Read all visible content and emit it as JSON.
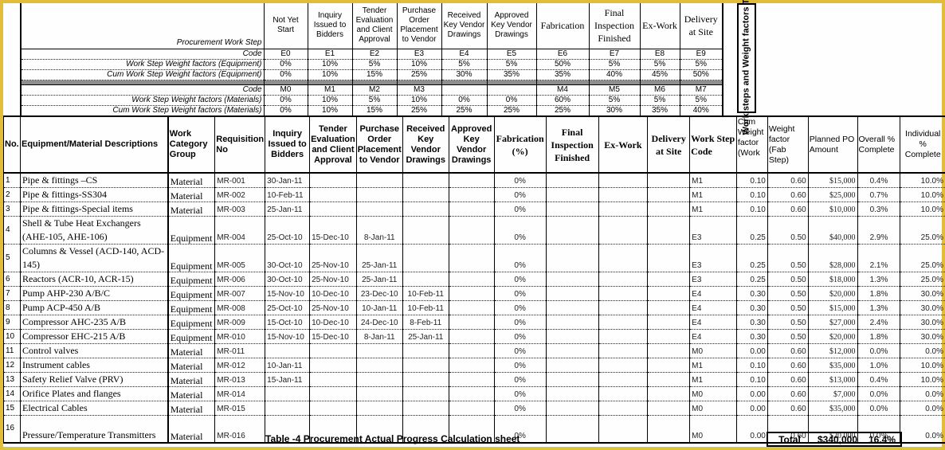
{
  "weight_table": {
    "side_title": "Work steps and Weight factors Table",
    "row_labels": {
      "step": "Procurement Work Step",
      "code_e": "Code",
      "weight_e": "Work Step Weight factors (Equipment)",
      "cum_e": "Cum Work Step Weight factors (Equipment)",
      "code_m": "Code",
      "weight_m": "Work Step Weight factors (Materials)",
      "cum_m": "Cum Work Step Weight factors (Materials)"
    },
    "steps": [
      {
        "name": "Not Yet Start",
        "code_e": "E0",
        "weight_e": "0%",
        "cum_e": "0%",
        "code_m": "M0",
        "weight_m": "0%",
        "cum_m": "0%"
      },
      {
        "name": "Inquiry Issued to Bidders",
        "code_e": "E1",
        "weight_e": "10%",
        "cum_e": "10%",
        "code_m": "M1",
        "weight_m": "10%",
        "cum_m": "10%"
      },
      {
        "name": "Tender Evaluation and Client Approval",
        "code_e": "E2",
        "weight_e": "5%",
        "cum_e": "15%",
        "code_m": "M2",
        "weight_m": "5%",
        "cum_m": "15%"
      },
      {
        "name": "Purchase Order Placement to Vendor",
        "code_e": "E3",
        "weight_e": "10%",
        "cum_e": "25%",
        "code_m": "M3",
        "weight_m": "10%",
        "cum_m": "25%"
      },
      {
        "name": "Received Key Vendor Drawings",
        "code_e": "E4",
        "weight_e": "5%",
        "cum_e": "30%",
        "code_m": "",
        "weight_m": "0%",
        "cum_m": "25%"
      },
      {
        "name": "Approved Key Vendor Drawings",
        "code_e": "E5",
        "weight_e": "5%",
        "cum_e": "35%",
        "code_m": "",
        "weight_m": "0%",
        "cum_m": "25%"
      },
      {
        "name": "Fabrication",
        "code_e": "E6",
        "weight_e": "50%",
        "cum_e": "35%",
        "code_m": "M4",
        "weight_m": "60%",
        "cum_m": "25%"
      },
      {
        "name": "Final Inspection Finished",
        "code_e": "E7",
        "weight_e": "5%",
        "cum_e": "40%",
        "code_m": "M5",
        "weight_m": "5%",
        "cum_m": "30%"
      },
      {
        "name": "Ex-Work",
        "code_e": "E8",
        "weight_e": "5%",
        "cum_e": "45%",
        "code_m": "M6",
        "weight_m": "5%",
        "cum_m": "35%"
      },
      {
        "name": "Delivery at Site",
        "code_e": "E9",
        "weight_e": "5%",
        "cum_e": "50%",
        "code_m": "M7",
        "weight_m": "5%",
        "cum_m": "40%"
      }
    ]
  },
  "main_table": {
    "headers": {
      "no": "No.",
      "desc": "Equipment/Material Descriptions",
      "category": "Work Category Group",
      "req": "Requisition No",
      "inquiry": "Inquiry Issued to Bidders",
      "tender": "Tender Evaluation and Client Approval",
      "po": "Purchase Order Placement to Vendor",
      "received": "Received Key Vendor Drawings",
      "approved": "Approved Key Vendor Drawings",
      "fabrication": "Fabrication (%)",
      "final": "Final Inspection Finished",
      "exwork": "Ex-Work",
      "delivery": "Delivery at Site",
      "step_code": "Work Step Code",
      "cum_weight": "Cum Weight factor (Work",
      "weight_fab": "Weight factor (Fab Step)",
      "planned_po": "Planned PO Amount",
      "overall": "Overall % Complete",
      "individual": "Individual % Complete"
    },
    "rows": [
      {
        "no": "1",
        "desc": "Pipe & fittings –CS",
        "category": "Material",
        "req": "MR-001",
        "inquiry": "30-Jan-11",
        "tender": "",
        "po": "",
        "received": "",
        "approved": "",
        "fabrication": "0%",
        "final": "",
        "exwork": "",
        "delivery": "",
        "step_code": "M1",
        "cum_weight": "0.10",
        "weight_fab": "0.60",
        "planned_po": "$15,000",
        "overall": "0.4%",
        "individual": "10.0%"
      },
      {
        "no": "2",
        "desc": "Pipe & fittings-SS304",
        "category": "Material",
        "req": "MR-002",
        "inquiry": "10-Feb-11",
        "tender": "",
        "po": "",
        "received": "",
        "approved": "",
        "fabrication": "0%",
        "final": "",
        "exwork": "",
        "delivery": "",
        "step_code": "M1",
        "cum_weight": "0.10",
        "weight_fab": "0.60",
        "planned_po": "$25,000",
        "overall": "0.7%",
        "individual": "10.0%"
      },
      {
        "no": "3",
        "desc": "Pipe & fittings-Special items",
        "category": "Material",
        "req": "MR-003",
        "inquiry": "25-Jan-11",
        "tender": "",
        "po": "",
        "received": "",
        "approved": "",
        "fabrication": "0%",
        "final": "",
        "exwork": "",
        "delivery": "",
        "step_code": "M1",
        "cum_weight": "0.10",
        "weight_fab": "0.60",
        "planned_po": "$10,000",
        "overall": "0.3%",
        "individual": "10.0%"
      },
      {
        "no": "4",
        "desc": "Shell & Tube Heat Exchangers (AHE-105, AHE-106)",
        "category": "Equipment",
        "req": "MR-004",
        "inquiry": "25-Oct-10",
        "tender": "15-Dec-10",
        "po": "8-Jan-11",
        "received": "",
        "approved": "",
        "fabrication": "0%",
        "final": "",
        "exwork": "",
        "delivery": "",
        "step_code": "E3",
        "cum_weight": "0.25",
        "weight_fab": "0.50",
        "planned_po": "$40,000",
        "overall": "2.9%",
        "individual": "25.0%",
        "tall": true
      },
      {
        "no": "5",
        "desc": "Columns & Vessel (ACD-140, ACD-145)",
        "category": "Equipment",
        "req": "MR-005",
        "inquiry": "30-Oct-10",
        "tender": "25-Nov-10",
        "po": "25-Jan-11",
        "received": "",
        "approved": "",
        "fabrication": "0%",
        "final": "",
        "exwork": "",
        "delivery": "",
        "step_code": "E3",
        "cum_weight": "0.25",
        "weight_fab": "0.50",
        "planned_po": "$28,000",
        "overall": "2.1%",
        "individual": "25.0%",
        "tall": true
      },
      {
        "no": "6",
        "desc": "Reactors (ACR-10, ACR-15)",
        "category": "Equipment",
        "req": "MR-006",
        "inquiry": "30-Oct-10",
        "tender": "25-Nov-10",
        "po": "25-Jan-11",
        "received": "",
        "approved": "",
        "fabrication": "0%",
        "final": "",
        "exwork": "",
        "delivery": "",
        "step_code": "E3",
        "cum_weight": "0.25",
        "weight_fab": "0.50",
        "planned_po": "$18,000",
        "overall": "1.3%",
        "individual": "25.0%"
      },
      {
        "no": "7",
        "desc": "Pump AHP-230 A/B/C",
        "category": "Equipment",
        "req": "MR-007",
        "inquiry": "15-Nov-10",
        "tender": "10-Dec-10",
        "po": "23-Dec-10",
        "received": "10-Feb-11",
        "approved": "",
        "fabrication": "0%",
        "final": "",
        "exwork": "",
        "delivery": "",
        "step_code": "E4",
        "cum_weight": "0.30",
        "weight_fab": "0.50",
        "planned_po": "$20,000",
        "overall": "1.8%",
        "individual": "30.0%"
      },
      {
        "no": "8",
        "desc": "Pump ACP-450 A/B",
        "category": "Equipment",
        "req": "MR-008",
        "inquiry": "25-Oct-10",
        "tender": "25-Nov-10",
        "po": "10-Jan-11",
        "received": "10-Feb-11",
        "approved": "",
        "fabrication": "0%",
        "final": "",
        "exwork": "",
        "delivery": "",
        "step_code": "E4",
        "cum_weight": "0.30",
        "weight_fab": "0.50",
        "planned_po": "$15,000",
        "overall": "1.3%",
        "individual": "30.0%"
      },
      {
        "no": "9",
        "desc": "Compressor AHC-235 A/B",
        "category": "Equipment",
        "req": "MR-009",
        "inquiry": "15-Oct-10",
        "tender": "10-Dec-10",
        "po": "24-Dec-10",
        "received": "8-Feb-11",
        "approved": "",
        "fabrication": "0%",
        "final": "",
        "exwork": "",
        "delivery": "",
        "step_code": "E4",
        "cum_weight": "0.30",
        "weight_fab": "0.50",
        "planned_po": "$27,000",
        "overall": "2.4%",
        "individual": "30.0%"
      },
      {
        "no": "10",
        "desc": "Compressor EHC-215 A/B",
        "category": "Equipment",
        "req": "MR-010",
        "inquiry": "15-Nov-10",
        "tender": "15-Dec-10",
        "po": "8-Jan-11",
        "received": "25-Jan-11",
        "approved": "",
        "fabrication": "0%",
        "final": "",
        "exwork": "",
        "delivery": "",
        "step_code": "E4",
        "cum_weight": "0.30",
        "weight_fab": "0.50",
        "planned_po": "$20,000",
        "overall": "1.8%",
        "individual": "30.0%"
      },
      {
        "no": "11",
        "desc": "Control valves",
        "category": "Material",
        "req": "MR-011",
        "inquiry": "",
        "tender": "",
        "po": "",
        "received": "",
        "approved": "",
        "fabrication": "0%",
        "final": "",
        "exwork": "",
        "delivery": "",
        "step_code": "M0",
        "cum_weight": "0.00",
        "weight_fab": "0.60",
        "planned_po": "$12,000",
        "overall": "0.0%",
        "individual": "0.0%"
      },
      {
        "no": "12",
        "desc": "Instrument cables",
        "category": "Material",
        "req": "MR-012",
        "inquiry": "10-Jan-11",
        "tender": "",
        "po": "",
        "received": "",
        "approved": "",
        "fabrication": "0%",
        "final": "",
        "exwork": "",
        "delivery": "",
        "step_code": "M1",
        "cum_weight": "0.10",
        "weight_fab": "0.60",
        "planned_po": "$35,000",
        "overall": "1.0%",
        "individual": "10.0%"
      },
      {
        "no": "13",
        "desc": "Safety Relief Valve (PRV)",
        "category": "Material",
        "req": "MR-013",
        "inquiry": "15-Jan-11",
        "tender": "",
        "po": "",
        "received": "",
        "approved": "",
        "fabrication": "0%",
        "final": "",
        "exwork": "",
        "delivery": "",
        "step_code": "M1",
        "cum_weight": "0.10",
        "weight_fab": "0.60",
        "planned_po": "$13,000",
        "overall": "0.4%",
        "individual": "10.0%"
      },
      {
        "no": "14",
        "desc": "Orifice Plates and flanges",
        "category": "Material",
        "req": "MR-014",
        "inquiry": "",
        "tender": "",
        "po": "",
        "received": "",
        "approved": "",
        "fabrication": "0%",
        "final": "",
        "exwork": "",
        "delivery": "",
        "step_code": "M0",
        "cum_weight": "0.00",
        "weight_fab": "0.60",
        "planned_po": "$7,000",
        "overall": "0.0%",
        "individual": "0.0%"
      },
      {
        "no": "15",
        "desc": "Electrical Cables",
        "category": "Material",
        "req": "MR-015",
        "inquiry": "",
        "tender": "",
        "po": "",
        "received": "",
        "approved": "",
        "fabrication": "0%",
        "final": "",
        "exwork": "",
        "delivery": "",
        "step_code": "M0",
        "cum_weight": "0.00",
        "weight_fab": "0.60",
        "planned_po": "$35,000",
        "overall": "0.0%",
        "individual": "0.0%"
      },
      {
        "no": "16",
        "desc": "Pressure/Temperature Transmitters",
        "category": "Material",
        "req": "MR-016",
        "inquiry": "",
        "tender": "",
        "po": "",
        "received": "",
        "approved": "",
        "fabrication": "0%",
        "final": "",
        "exwork": "",
        "delivery": "",
        "step_code": "M0",
        "cum_weight": "0.00",
        "weight_fab": "0.60",
        "planned_po": "$20,000",
        "overall": "0.0%",
        "individual": "0.0%",
        "tall": true
      }
    ]
  },
  "caption": "Table -4 Procurement Actual Progress Calculation sheet",
  "totals": {
    "label": "Total",
    "amount": "$340,000",
    "percent": "16.4%"
  }
}
